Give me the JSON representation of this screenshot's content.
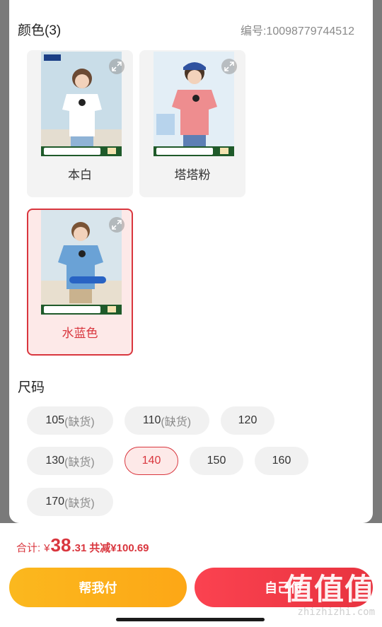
{
  "colors": {
    "heading": "颜色(3)",
    "code": "编号:10098779744512",
    "options": [
      {
        "label": "本白",
        "selected": false,
        "shirt_color": "#ffffff"
      },
      {
        "label": "塔塔粉",
        "selected": false,
        "shirt_color": "#ee8d8f"
      },
      {
        "label": "水蓝色",
        "selected": true,
        "shirt_color": "#6aa2d6"
      }
    ]
  },
  "sizes": {
    "heading": "尺码",
    "options": [
      {
        "value": "105",
        "note": "(缺货)",
        "available": false,
        "selected": false
      },
      {
        "value": "110",
        "note": "(缺货)",
        "available": false,
        "selected": false
      },
      {
        "value": "120",
        "note": "",
        "available": true,
        "selected": false
      },
      {
        "value": "130",
        "note": "(缺货)",
        "available": false,
        "selected": false
      },
      {
        "value": "140",
        "note": "",
        "available": true,
        "selected": true
      },
      {
        "value": "150",
        "note": "",
        "available": true,
        "selected": false
      },
      {
        "value": "160",
        "note": "",
        "available": true,
        "selected": false
      },
      {
        "value": "170",
        "note": "(缺货)",
        "available": false,
        "selected": false
      }
    ]
  },
  "summary": {
    "total_label": "合计:",
    "currency": "¥",
    "price_int": "38",
    "price_dec": ".31",
    "discount": "共减¥100.69"
  },
  "actions": {
    "help_pay": "帮我付",
    "self_pay": "自己付"
  },
  "watermark": {
    "text": "值值值",
    "url": "zhizhizhi.com"
  },
  "theme": {
    "accent": "#d9363e",
    "help_button": "#fbb81e",
    "self_button": "#fb4250"
  }
}
